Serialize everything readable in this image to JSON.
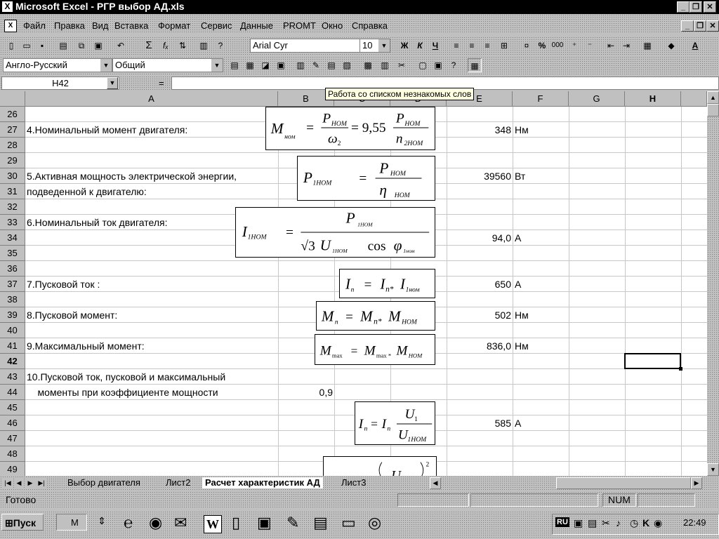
{
  "window": {
    "title": "Microsoft Excel - РГР выбор АД.xls"
  },
  "menu": {
    "items": [
      "Файл",
      "Правка",
      "Вид",
      "Вставка",
      "Формат",
      "Сервис",
      "Данные",
      "PROMT",
      "Окно",
      "Справка"
    ]
  },
  "toolbar": {
    "font": "Arial Cyr",
    "size": "10",
    "bold": "Ж",
    "italic": "К",
    "underline": "Ч",
    "sigma": "Σ",
    "fx": "fₓ",
    "percent": "%",
    "thousands": "000"
  },
  "promt": {
    "direction": "Англо-Русский",
    "dictionary": "Общий"
  },
  "formula_bar": {
    "name_box": "H42",
    "equals": "="
  },
  "tooltip": "Работа со списком незнакомых слов",
  "columns": [
    "A",
    "B",
    "C",
    "D",
    "E",
    "F",
    "G",
    "H"
  ],
  "rows": [
    "26",
    "27",
    "28",
    "29",
    "30",
    "31",
    "32",
    "33",
    "34",
    "35",
    "36",
    "37",
    "38",
    "39",
    "40",
    "41",
    "42",
    "43",
    "44",
    "45",
    "46",
    "47",
    "48",
    "49"
  ],
  "cells": {
    "a27": "4.Номинальный момент двигателя:",
    "a30": "5.Активная мощность электрической энергии,",
    "a31": " подведенной к двигателю:",
    "a33": "6.Номинальный ток двигателя:",
    "a37": "7.Пусковой ток :",
    "a39": "8.Пусковой момент:",
    "a41": "9.Максимальный момент:",
    "a43": "10.Пусковой ток, пусковой и максимальный",
    "a44": "    моменты при коэффициенте мощности",
    "b44": "0,9",
    "e27": "348",
    "f27": "Нм",
    "e30": "39560",
    "f30": "Вт",
    "e34": "94,0",
    "f34": "А",
    "e37": "650",
    "f37": "А",
    "e39": "502",
    "f39": "Нм",
    "e41": "836,0",
    "f41": "Нм",
    "e46": "585",
    "f46": "А"
  },
  "formulas": {
    "f27": {
      "M": "M",
      "nom": "ном",
      "P": "P",
      "PNOM": "НОМ",
      "omega": "ω",
      "two": "2",
      "eq": "=",
      "coef": "= 9,55",
      "n": "n",
      "n2": "2НОМ"
    },
    "f30": {
      "P": "P",
      "sub": "1НОМ",
      "eq": "=",
      "num_sub": "НОМ",
      "eta": "η",
      "eta_sub": "НОМ"
    },
    "f33": {
      "I": "I",
      "sub": "1НОМ",
      "eq": "=",
      "P": "P",
      "psub": "1НОМ",
      "sqrt3": "√3",
      "U": "U",
      "usub": "1НОМ",
      "cos": "cos",
      "phi": "φ",
      "phisub": "1ном"
    },
    "f37": {
      "lhs": "I",
      "lhs_sub": "п",
      "eq": "=",
      "r1": "I",
      "r1sub": "п*",
      "r2": "I",
      "r2sub": "1ном"
    },
    "f39": {
      "lhs": "M",
      "lhs_sub": "п",
      "eq": "=",
      "r1": "M",
      "r1sub": "п*",
      "r2": "M",
      "r2sub": "НОМ"
    },
    "f41": {
      "lhs": "M",
      "lhs_sub": "max",
      "eq": "=",
      "r1": "M",
      "r1sub": "max *",
      "r2": "M",
      "r2sub": "НОМ"
    },
    "f46": {
      "lhs": "I",
      "lhs_sub": "п",
      "eq": "=",
      "r1": "I",
      "r1sub": "п",
      "U": "U",
      "usub": "1",
      "U2": "U",
      "u2sub": "1НОМ"
    },
    "f49": {
      "U": "U",
      "pow": "2"
    }
  },
  "sheets": {
    "tab1": "Выбор двигателя",
    "tab2": "Лист2",
    "tab3": "Расчет характеристик АД",
    "tab4": "Лист3"
  },
  "status": {
    "ready": "Готово",
    "num": "NUM"
  },
  "taskbar": {
    "start": "Пуск",
    "task": "M",
    "lang": "RU",
    "clock": "22:49"
  }
}
